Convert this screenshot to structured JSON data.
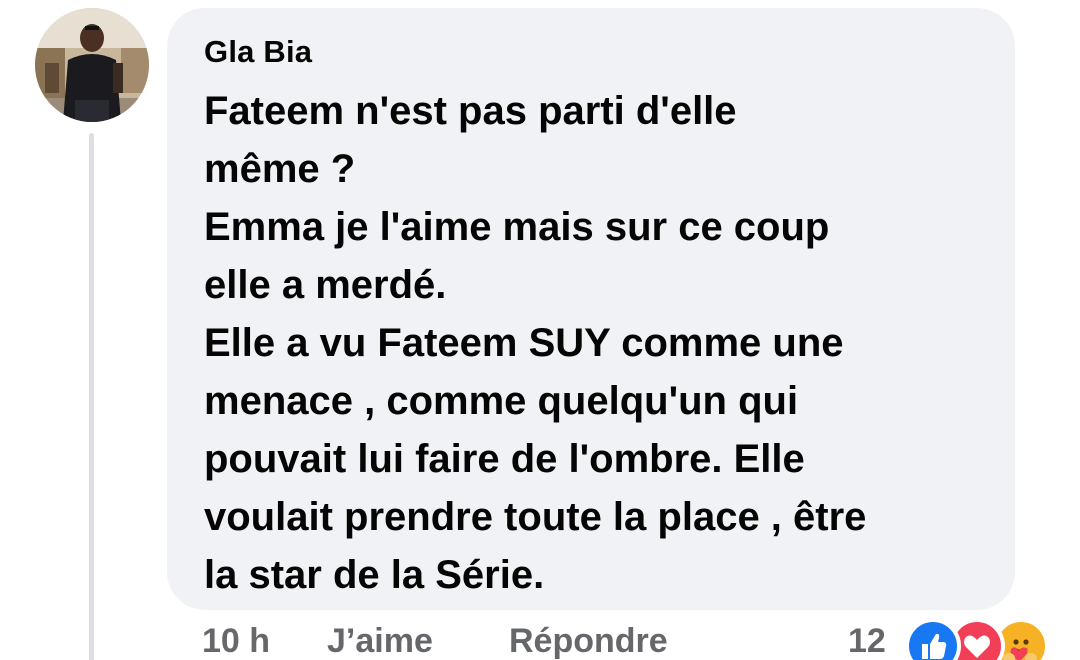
{
  "comment": {
    "author": "Gla Bia",
    "lines": [
      "Fateem n'est pas parti d'elle",
      "même ?",
      "Emma je l'aime mais sur ce coup",
      "elle a merdé.",
      "Elle a vu Fateem SUY comme une",
      "menace , comme quelqu'un qui",
      "pouvait lui faire de l'ombre. Elle",
      "voulait prendre toute la place , être",
      "la star de la Série."
    ]
  },
  "actions": {
    "time": "10 h",
    "like_label": "J’aime",
    "reply_label": "Répondre"
  },
  "reactions": {
    "count": "12",
    "icons": [
      "like-icon",
      "love-icon",
      "care-icon"
    ],
    "colors": {
      "like": "#1877f2",
      "love": "#f33e58",
      "care": "#f7b125"
    }
  },
  "colors": {
    "bubble": "#f0f2f5",
    "text": "#050505",
    "secondary": "#65676b"
  }
}
